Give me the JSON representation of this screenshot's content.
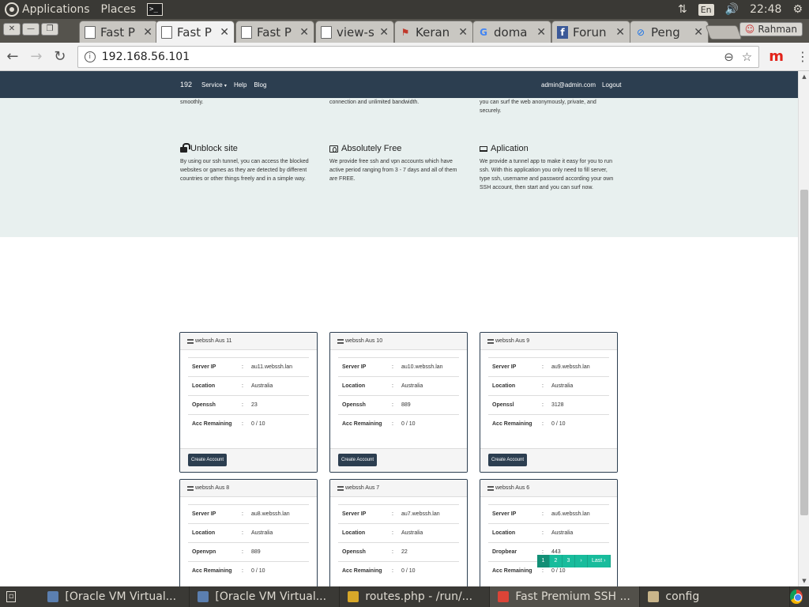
{
  "top_panel": {
    "applications": "Applications",
    "places": "Places",
    "terminal_glyph": ">_",
    "network_glyph": "⇅",
    "lang": "En",
    "volume_glyph": "🔊",
    "clock": "22:48",
    "settings_glyph": "⚙"
  },
  "browser": {
    "window_buttons": [
      "✕",
      "—",
      "❐"
    ],
    "tabs": [
      {
        "title": "Fast P",
        "icon": "document-icon"
      },
      {
        "title": "Fast P",
        "icon": "document-icon",
        "active": true
      },
      {
        "title": "Fast P",
        "icon": "document-icon"
      },
      {
        "title": "view-s",
        "icon": "document-icon"
      },
      {
        "title": "Keran",
        "icon": "flag-icon"
      },
      {
        "title": "doma",
        "icon": "google-icon"
      },
      {
        "title": "Forun",
        "icon": "facebook-icon"
      },
      {
        "title": "Peng",
        "icon": "link-icon"
      }
    ],
    "tab_close": "✕",
    "tab_glyphs": [
      "",
      "",
      "",
      "",
      "⚑",
      "G",
      "f",
      "⊘"
    ],
    "profile_name": "Rahman",
    "profile_glyph": "☺",
    "url": "192.168.56.101",
    "info_glyph": "i",
    "back": "←",
    "forward": "→",
    "reload": "↻",
    "zoom_glyph": "⊖",
    "star_glyph": "☆",
    "ext_glyph": "m",
    "menu_glyph": "⋮"
  },
  "site": {
    "nav": {
      "brand": "192",
      "links": [
        "Service",
        "Help",
        "Blog"
      ],
      "dropdown_caret": "▾",
      "user": "admin@admin.com",
      "logout": "Logout"
    },
    "feature_tops": [
      "smoothly.",
      "connection and unlimited bandwidth.",
      "you can surf the web anonymously, private, and\nsecurely."
    ],
    "features": [
      {
        "title": "Unblock site",
        "icon": "lock-icon",
        "text": "By using our ssh tunnel, you can access the blocked websites or games as they are detected by different countries or other things freely and in a simple way."
      },
      {
        "title": "Absolutely Free",
        "icon": "money-icon",
        "text": "We provide free ssh and vpn accounts which have active period ranging from 3 - 7 days and all of them are FREE."
      },
      {
        "title": "Aplication",
        "icon": "laptop-icon",
        "text": "We provide a tunnel app to make it easy for you to run ssh. With this application you only need to fill server, type ssh, username and password according your own SSH account, then start and you can surf now."
      }
    ],
    "servers": [
      {
        "name": "webssh Aus 11",
        "rows": [
          [
            "Server IP",
            "au11.webssh.lan"
          ],
          [
            "Location",
            "Australia"
          ],
          [
            "Openssh",
            "23"
          ],
          [
            "Acc Remaining",
            "0 / 10"
          ]
        ]
      },
      {
        "name": "webssh Aus 10",
        "rows": [
          [
            "Server IP",
            "au10.webssh.lan"
          ],
          [
            "Location",
            "Australia"
          ],
          [
            "Openssh",
            "889"
          ],
          [
            "Acc Remaining",
            "0 / 10"
          ]
        ]
      },
      {
        "name": "webssh Aus 9",
        "rows": [
          [
            "Server IP",
            "au9.webssh.lan"
          ],
          [
            "Location",
            "Australia"
          ],
          [
            "Openssl",
            "3128"
          ],
          [
            "Acc Remaining",
            "0 / 10"
          ]
        ]
      },
      {
        "name": "webssh Aus 8",
        "rows": [
          [
            "Server IP",
            "au8.webssh.lan"
          ],
          [
            "Location",
            "Australia"
          ],
          [
            "Openvpn",
            "889"
          ],
          [
            "Acc Remaining",
            "0 / 10"
          ]
        ]
      },
      {
        "name": "webssh Aus 7",
        "rows": [
          [
            "Server IP",
            "au7.webssh.lan"
          ],
          [
            "Location",
            "Australia"
          ],
          [
            "Openssh",
            "22"
          ],
          [
            "Acc Remaining",
            "0 / 10"
          ]
        ]
      },
      {
        "name": "webssh Aus 6",
        "rows": [
          [
            "Server IP",
            "au6.webssh.lan"
          ],
          [
            "Location",
            "Australia"
          ],
          [
            "Dropbear",
            "443"
          ],
          [
            "Acc Remaining",
            "0 / 10"
          ]
        ]
      }
    ],
    "row_sep": ":",
    "create_account": "Create Account",
    "pagination": [
      "1",
      "2",
      "3",
      "›",
      "Last ›"
    ],
    "scroll_up": "▲",
    "scroll_down": "▼"
  },
  "taskbar": {
    "show_desktop_glyph": "▫",
    "tasks": [
      {
        "label": "[Oracle VM Virtual...",
        "icon": "virtualbox-icon",
        "color": "#5b7fb0"
      },
      {
        "label": "[Oracle VM Virtual...",
        "icon": "virtualbox-icon",
        "color": "#5b7fb0"
      },
      {
        "label": "routes.php - /run/...",
        "icon": "editor-icon",
        "color": "#d8a829"
      },
      {
        "label": "Fast Premium SSH ...",
        "icon": "chrome-icon",
        "color": "#db4437",
        "active": true
      },
      {
        "label": "config",
        "icon": "file-icon",
        "color": "#c9b58a"
      }
    ]
  }
}
